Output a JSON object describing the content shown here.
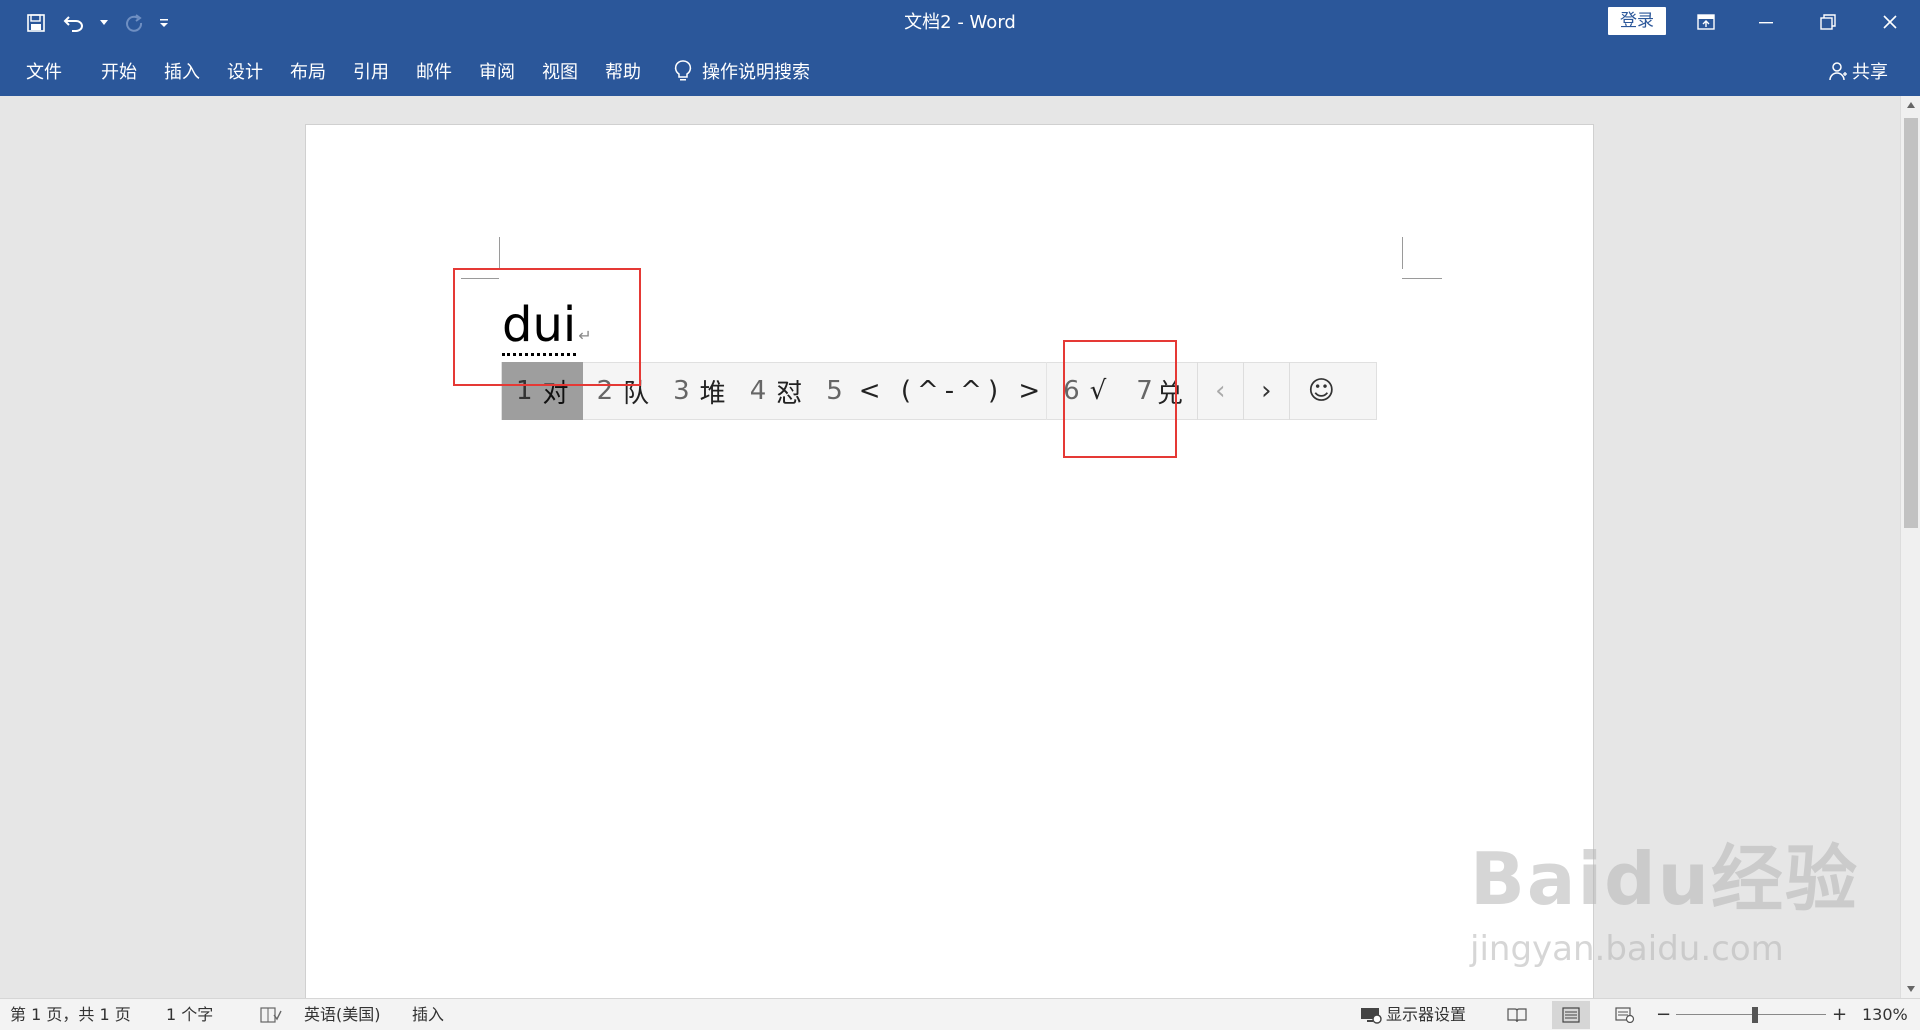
{
  "titlebar": {
    "title": "文档2  -  Word",
    "login_label": "登录"
  },
  "ribbon": {
    "tabs": [
      "文件",
      "开始",
      "插入",
      "设计",
      "布局",
      "引用",
      "邮件",
      "审阅",
      "视图",
      "帮助"
    ],
    "tell_me": "操作说明搜索",
    "share": "共享"
  },
  "document": {
    "typed_text": "dui",
    "paragraph_mark": "↵"
  },
  "ime": {
    "candidates": [
      {
        "num": "1",
        "text": "对",
        "selected": true
      },
      {
        "num": "2",
        "text": "队"
      },
      {
        "num": "3",
        "text": "堆"
      },
      {
        "num": "4",
        "text": "怼"
      },
      {
        "num": "5",
        "text": "< (^-^) >"
      },
      {
        "num": "6",
        "text": "√"
      },
      {
        "num": "7",
        "text": "兑"
      }
    ],
    "prev": "‹",
    "next": "›",
    "emoji": "☺"
  },
  "watermark": {
    "brand": "Baidu经验",
    "url": "jingyan.baidu.com"
  },
  "statusbar": {
    "page_info": "第 1 页，共 1 页",
    "word_count": "1 个字",
    "language": "英语(美国)",
    "mode": "插入",
    "display_settings": "显示器设置",
    "zoom_minus": "−",
    "zoom_plus": "+",
    "zoom_level": "130%"
  }
}
